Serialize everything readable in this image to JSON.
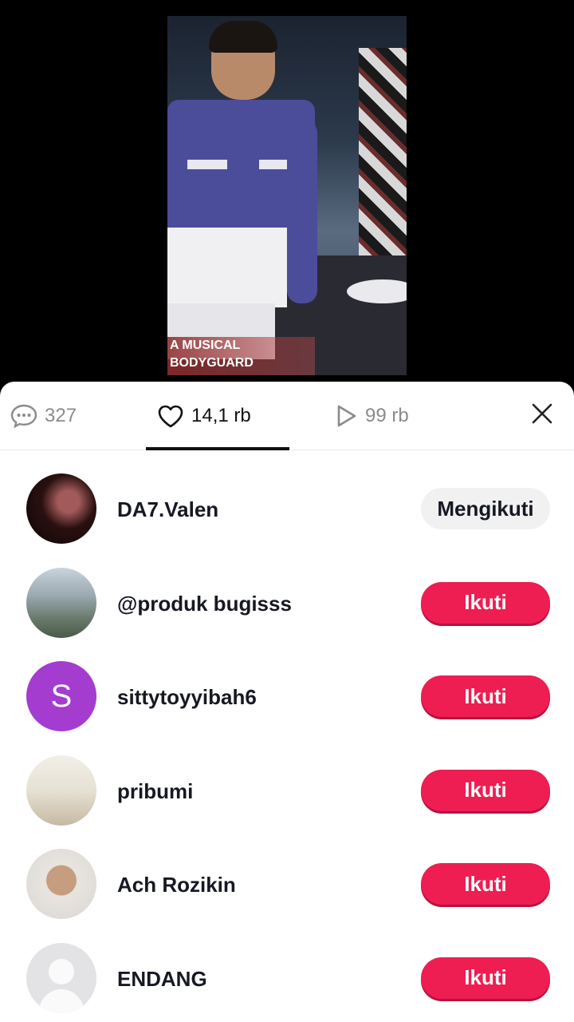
{
  "video": {
    "caption_line1": "A MUSICAL",
    "caption_line2": "BODYGUARD"
  },
  "tabs": {
    "comments": {
      "icon": "comment-icon",
      "count": "327"
    },
    "likes": {
      "icon": "heart-icon",
      "count": "14,1 rb"
    },
    "views": {
      "icon": "play-icon",
      "count": "99 rb"
    },
    "close_icon": "close-icon"
  },
  "colors": {
    "follow_button": "#ee1d52",
    "following_button": "#f1f1f2"
  },
  "users": [
    {
      "name": "DA7.Valen",
      "button": "Mengikuti",
      "state": "following"
    },
    {
      "name": "@produk bugisss",
      "button": "Ikuti",
      "state": "follow"
    },
    {
      "name": "sittytoyyibah6",
      "button": "Ikuti",
      "state": "follow",
      "initial": "S"
    },
    {
      "name": "pribumi",
      "button": "Ikuti",
      "state": "follow"
    },
    {
      "name": "Ach Rozikin",
      "button": "Ikuti",
      "state": "follow"
    },
    {
      "name": "ENDANG",
      "button": "Ikuti",
      "state": "follow"
    }
  ]
}
